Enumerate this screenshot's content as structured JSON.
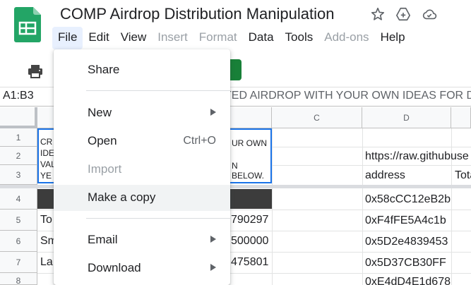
{
  "doc": {
    "title": "COMP Airdrop Distribution Manipulation"
  },
  "menubar": [
    {
      "label": "File",
      "state": "active"
    },
    {
      "label": "Edit",
      "state": "normal"
    },
    {
      "label": "View",
      "state": "normal"
    },
    {
      "label": "Insert",
      "state": "disabled"
    },
    {
      "label": "Format",
      "state": "disabled"
    },
    {
      "label": "Data",
      "state": "normal"
    },
    {
      "label": "Tools",
      "state": "normal"
    },
    {
      "label": "Add-ons",
      "state": "disabled"
    },
    {
      "label": "Help",
      "state": "normal"
    }
  ],
  "title_icons": [
    "star-icon",
    "move-to-drive-icon",
    "cloud-saved-icon"
  ],
  "formula_bar": {
    "name_box": "A1:B3",
    "formula": "TED AIRDROP WITH YOUR OWN IDEAS FOR DIS"
  },
  "columns": {
    "c": "C",
    "d": "D"
  },
  "rows": [
    "1",
    "2",
    "3",
    "4",
    "5",
    "6",
    "7",
    "8"
  ],
  "merged_cell": {
    "left_lines": [
      "CR",
      "IDE",
      "VAL",
      "YE"
    ],
    "right_lines": [
      "UR OWN",
      "",
      "N",
      "BELOW."
    ]
  },
  "col_b_values": {
    "r5": "790297",
    "r6": "500000",
    "r7": "475801"
  },
  "col_a_values": {
    "r5": "To",
    "r6": "Sm",
    "r7": "La"
  },
  "col_d_values": {
    "r2": "https://raw.githubuse",
    "r3": "address",
    "r4": "0x58cCC12eB2b",
    "r5": "0xF4fFE5A4c1b",
    "r6": "0x5D2e4839453",
    "r7": "0x5D37CB30FF",
    "r8": "0xE4dD4E1d678"
  },
  "col_e_values": {
    "r3": "Tota"
  },
  "file_menu": {
    "items": [
      {
        "name": "share",
        "label": "Share",
        "shortcut": "",
        "submenu": false,
        "disabled": false
      },
      {
        "name": "new",
        "label": "New",
        "shortcut": "",
        "submenu": true,
        "disabled": false
      },
      {
        "name": "open",
        "label": "Open",
        "shortcut": "Ctrl+O",
        "submenu": false,
        "disabled": false
      },
      {
        "name": "import",
        "label": "Import",
        "shortcut": "",
        "submenu": false,
        "disabled": true
      },
      {
        "name": "make-a-copy",
        "label": "Make a copy",
        "shortcut": "",
        "submenu": false,
        "disabled": false
      },
      {
        "name": "email",
        "label": "Email",
        "shortcut": "",
        "submenu": true,
        "disabled": false
      },
      {
        "name": "download",
        "label": "Download",
        "shortcut": "",
        "submenu": true,
        "disabled": false
      }
    ],
    "highlighted": "Make a copy"
  },
  "colors": {
    "accent_green": "#188038",
    "selection_blue": "#1a73e8",
    "menu_text": "#202124",
    "disabled_text": "#9aa0a6"
  }
}
